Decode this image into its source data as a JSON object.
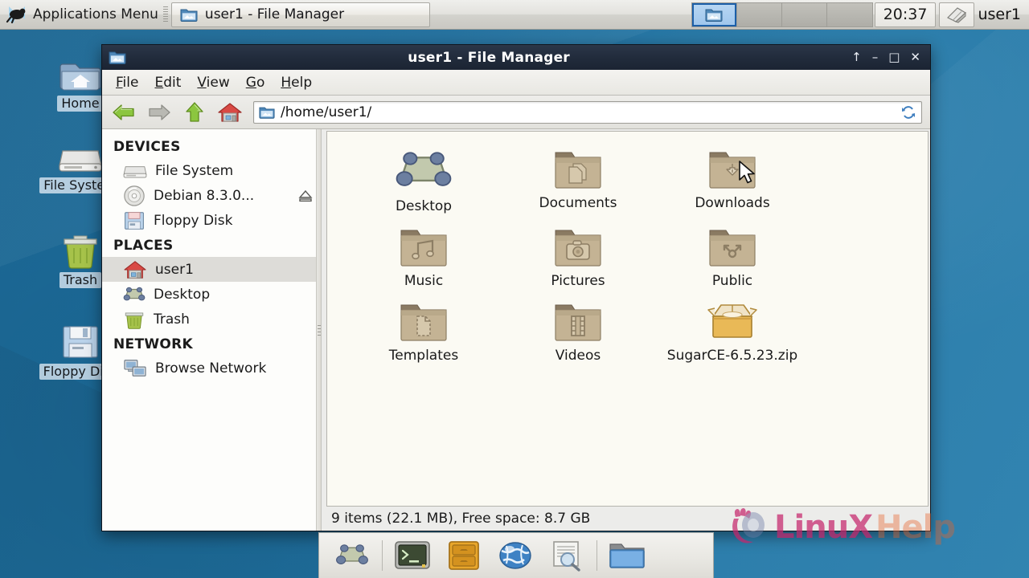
{
  "panel": {
    "apps_menu_label": "Applications Menu",
    "task_button_label": "user1 - File Manager",
    "clock": "20:37",
    "username": "user1",
    "workspace_count": 4,
    "active_workspace": 1
  },
  "desktop": {
    "icons": [
      {
        "label": "Home",
        "icon": "home-folder-icon"
      },
      {
        "label": "File System",
        "icon": "hard-drive-icon"
      },
      {
        "label": "Trash",
        "icon": "trash-icon"
      },
      {
        "label": "Floppy Disk",
        "icon": "floppy-disk-icon"
      }
    ],
    "background_color": "#1d6d9c"
  },
  "window": {
    "title": "user1 - File Manager",
    "buttons": {
      "shade": "↑",
      "minimize": "–",
      "maximize": "□",
      "close": "✕"
    },
    "menus": [
      {
        "label": "File",
        "accel": "F",
        "rest": "ile"
      },
      {
        "label": "Edit",
        "accel": "E",
        "rest": "dit"
      },
      {
        "label": "View",
        "accel": "V",
        "rest": "iew"
      },
      {
        "label": "Go",
        "accel": "G",
        "rest": "o"
      },
      {
        "label": "Help",
        "accel": "H",
        "rest": "elp"
      }
    ],
    "toolbar": {
      "back": "back-arrow",
      "forward": "forward-arrow",
      "up": "up-arrow",
      "home": "home-icon",
      "reload": "reload-icon",
      "path_value": "/home/user1/",
      "path_placeholder": "/home/user1/"
    },
    "sidebar": {
      "sections": [
        {
          "title": "DEVICES",
          "items": [
            {
              "label": "File System",
              "icon": "hard-drive-icon",
              "selected": false,
              "eject": false
            },
            {
              "label": "Debian 8.3.0...",
              "icon": "optical-disc-icon",
              "selected": false,
              "eject": true
            },
            {
              "label": "Floppy Disk",
              "icon": "floppy-disk-icon",
              "selected": false,
              "eject": false
            }
          ]
        },
        {
          "title": "PLACES",
          "items": [
            {
              "label": "user1",
              "icon": "home-icon",
              "selected": true,
              "eject": false
            },
            {
              "label": "Desktop",
              "icon": "desktop-icon",
              "selected": false,
              "eject": false
            },
            {
              "label": "Trash",
              "icon": "trash-icon",
              "selected": false,
              "eject": false
            }
          ]
        },
        {
          "title": "NETWORK",
          "items": [
            {
              "label": "Browse Network",
              "icon": "network-icon",
              "selected": false,
              "eject": false
            }
          ]
        }
      ]
    },
    "files": [
      {
        "name": "Desktop",
        "icon": "desktop-icon"
      },
      {
        "name": "Documents",
        "icon": "folder-documents-icon"
      },
      {
        "name": "Downloads",
        "icon": "folder-downloads-icon"
      },
      {
        "name": "Music",
        "icon": "folder-music-icon"
      },
      {
        "name": "Pictures",
        "icon": "folder-pictures-icon"
      },
      {
        "name": "Public",
        "icon": "folder-public-icon"
      },
      {
        "name": "Templates",
        "icon": "folder-templates-icon"
      },
      {
        "name": "Videos",
        "icon": "folder-videos-icon"
      },
      {
        "name": "SugarCE-6.5.23.zip",
        "icon": "archive-box-icon"
      }
    ],
    "statusbar": "9 items (22.1 MB), Free space: 8.7 GB"
  },
  "dock": {
    "items": [
      {
        "name": "show-desktop",
        "icon": "desktop-icon"
      },
      {
        "name": "terminal",
        "icon": "terminal-icon"
      },
      {
        "name": "file-manager",
        "icon": "file-cabinet-icon"
      },
      {
        "name": "web-browser",
        "icon": "globe-icon"
      },
      {
        "name": "find-files",
        "icon": "search-document-icon"
      },
      {
        "name": "open-folder",
        "icon": "folder-blue-icon"
      }
    ]
  },
  "watermark": {
    "text_primary": "LinuX",
    "text_secondary": "Help"
  }
}
